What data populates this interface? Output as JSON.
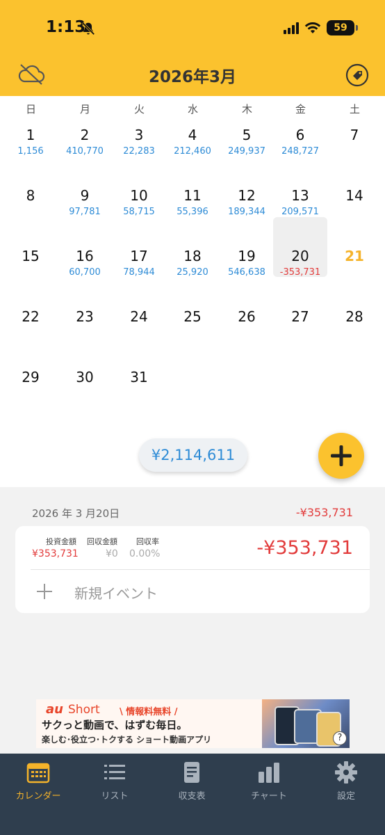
{
  "status_bar": {
    "time": "1:13",
    "battery": "59"
  },
  "header": {
    "title": "2026年3月"
  },
  "weekdays": [
    "日",
    "月",
    "火",
    "水",
    "木",
    "金",
    "土"
  ],
  "days": [
    {
      "day": "1",
      "amount": "1,156"
    },
    {
      "day": "2",
      "amount": "410,770"
    },
    {
      "day": "3",
      "amount": "22,283"
    },
    {
      "day": "4",
      "amount": "212,460"
    },
    {
      "day": "5",
      "amount": "249,937"
    },
    {
      "day": "6",
      "amount": "248,727"
    },
    {
      "day": "7",
      "amount": ""
    },
    {
      "day": "8",
      "amount": ""
    },
    {
      "day": "9",
      "amount": "97,781"
    },
    {
      "day": "10",
      "amount": "58,715"
    },
    {
      "day": "11",
      "amount": "55,396"
    },
    {
      "day": "12",
      "amount": "189,344"
    },
    {
      "day": "13",
      "amount": "209,571"
    },
    {
      "day": "14",
      "amount": ""
    },
    {
      "day": "15",
      "amount": ""
    },
    {
      "day": "16",
      "amount": "60,700"
    },
    {
      "day": "17",
      "amount": "78,944"
    },
    {
      "day": "18",
      "amount": "25,920"
    },
    {
      "day": "19",
      "amount": "546,638"
    },
    {
      "day": "20",
      "amount": "-353,731",
      "negative": true,
      "selected": true
    },
    {
      "day": "21",
      "amount": "",
      "today": true
    },
    {
      "day": "22",
      "amount": ""
    },
    {
      "day": "23",
      "amount": ""
    },
    {
      "day": "24",
      "amount": ""
    },
    {
      "day": "25",
      "amount": ""
    },
    {
      "day": "26",
      "amount": ""
    },
    {
      "day": "27",
      "amount": ""
    },
    {
      "day": "28",
      "amount": ""
    },
    {
      "day": "29",
      "amount": ""
    },
    {
      "day": "30",
      "amount": ""
    },
    {
      "day": "31",
      "amount": ""
    }
  ],
  "month_total": "¥2,114,611",
  "detail": {
    "date": "2026 年 3 月20日",
    "total": "-¥353,731",
    "invest_label": "投資金額",
    "invest_value": "¥353,731",
    "recover_label": "回収金額",
    "recover_value": "¥0",
    "rate_label": "回収率",
    "rate_value": "0.00%",
    "big_amount": "-¥353,731",
    "new_event": "新規イベント"
  },
  "ad": {
    "logo": "au",
    "brand": "Short",
    "badge": "\\ 情報料無料 /",
    "headline": "サクっと動画で、はずむ毎日。",
    "sub": "楽しむ･役立つ･トクする ショート動画アプリ",
    "help": "?"
  },
  "tabs": [
    {
      "label": "カレンダー",
      "icon": "calendar-icon",
      "active": true
    },
    {
      "label": "リスト",
      "icon": "list-icon"
    },
    {
      "label": "収支表",
      "icon": "document-icon"
    },
    {
      "label": "チャート",
      "icon": "bar-chart-icon"
    },
    {
      "label": "設定",
      "icon": "gear-icon"
    }
  ],
  "colors": {
    "accent": "#fbc22e",
    "positive": "#2d8bd6",
    "negative": "#e23b3b",
    "tabbar": "#2f3e4e",
    "today": "#f5b32a"
  }
}
